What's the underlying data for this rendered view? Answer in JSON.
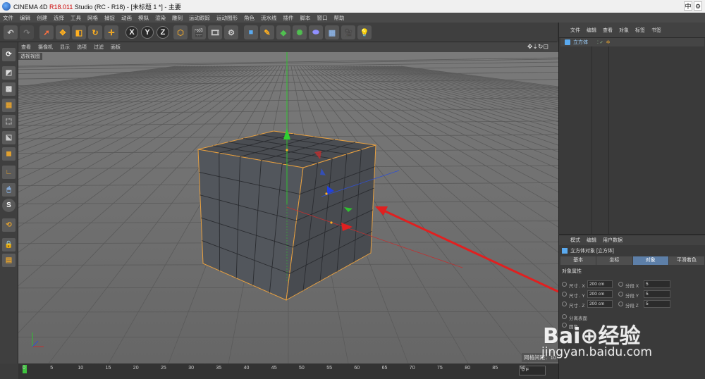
{
  "titlebar": {
    "title_prefix": "CINEMA 4D ",
    "version": "R18.011",
    "title_suffix": " Studio (RC - R18) - [未标题 1 *] - 主要",
    "ime": "中"
  },
  "menubar": [
    "文件",
    "编辑",
    "创建",
    "选择",
    "工具",
    "网格",
    "捕捉",
    "动画",
    "模拟",
    "渲染",
    "雕刻",
    "运动跟踪",
    "运动图形",
    "角色",
    "流水线",
    "插件",
    "脚本",
    "窗口",
    "帮助"
  ],
  "toolbar": {
    "x_label": "X",
    "y_label": "Y",
    "z_label": "Z"
  },
  "viewport": {
    "menu": [
      "查看",
      "摄像机",
      "显示",
      "选项",
      "过滤",
      "面板"
    ],
    "label": "透视视图",
    "grid_info": "网格间距：10",
    "nav": "✥⇣↻⊡"
  },
  "timeline": {
    "ticks": [
      "0",
      "5",
      "10",
      "15",
      "20",
      "25",
      "30",
      "35",
      "40",
      "45",
      "50",
      "55",
      "60",
      "65",
      "70",
      "75",
      "80",
      "85",
      "90"
    ],
    "frame": "0 F"
  },
  "object_manager": {
    "menu": [
      "文件",
      "编辑",
      "查看",
      "对象",
      "标签",
      "书签"
    ],
    "object_name": "立方体"
  },
  "attribute_manager": {
    "menu": [
      "模式",
      "编辑",
      "用户数据"
    ],
    "object_title": "立方体对象 [立方体]",
    "tabs": [
      "基本",
      "坐标",
      "对象",
      "平滑着色"
    ],
    "active_tab": "对象",
    "section": "对象属性",
    "rows": [
      {
        "label": "尺寸 . X",
        "value": "200 cm",
        "label2": "分段 X",
        "value2": "5"
      },
      {
        "label": "尺寸 . Y",
        "value": "200 cm",
        "label2": "分段 Y",
        "value2": "5"
      },
      {
        "label": "尺寸 . Z",
        "value": "200 cm",
        "label2": "分段 Z",
        "value2": "5"
      }
    ],
    "extra": [
      "分离表面",
      "圆角"
    ]
  },
  "watermark": {
    "logo": "Bai⊕经验",
    "url": "jingyan.baidu.com"
  },
  "colors": {
    "accent": "#5d7fa8",
    "cube_edge": "#e8a040",
    "annotation_arrow": "#e02020"
  }
}
